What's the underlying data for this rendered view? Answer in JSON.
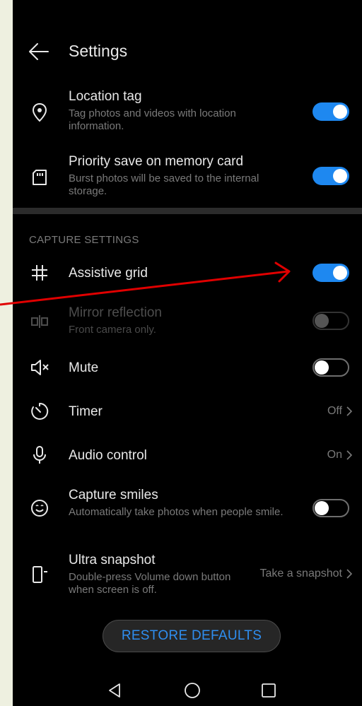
{
  "header": {
    "title": "Settings"
  },
  "rows_top": {
    "location_tag": {
      "label": "Location tag",
      "sub": "Tag photos and videos with location information.",
      "state": "on"
    },
    "priority_save": {
      "label": "Priority save on memory card",
      "sub": "Burst photos will be saved to the internal storage.",
      "state": "on"
    }
  },
  "capture": {
    "section_title": "CAPTURE SETTINGS",
    "assistive_grid": {
      "label": "Assistive grid",
      "state": "on"
    },
    "mirror_reflection": {
      "label": "Mirror reflection",
      "sub": "Front camera only.",
      "state": "disabled"
    },
    "mute": {
      "label": "Mute",
      "state": "off"
    },
    "timer": {
      "label": "Timer",
      "value": "Off"
    },
    "audio_control": {
      "label": "Audio control",
      "value": "On"
    },
    "capture_smiles": {
      "label": "Capture smiles",
      "sub": "Automatically take photos when people smile.",
      "state": "off"
    },
    "ultra_snapshot": {
      "label": "Ultra snapshot",
      "sub": "Double-press Volume down button when screen is off.",
      "value": "Take a snapshot"
    }
  },
  "footer": {
    "restore_label": "RESTORE DEFAULTS"
  },
  "colors": {
    "accent": "#1e88f0",
    "background": "#000000",
    "page_bg": "#eef0e0",
    "annotation_arrow": "#e00000"
  },
  "icons": [
    "back-arrow-icon",
    "location-pin-icon",
    "sd-card-icon",
    "grid-icon",
    "mirror-icon",
    "mute-icon",
    "timer-icon",
    "microphone-icon",
    "smile-icon",
    "phone-snapshot-icon",
    "nav-back-icon",
    "nav-home-icon",
    "nav-recents-icon"
  ]
}
